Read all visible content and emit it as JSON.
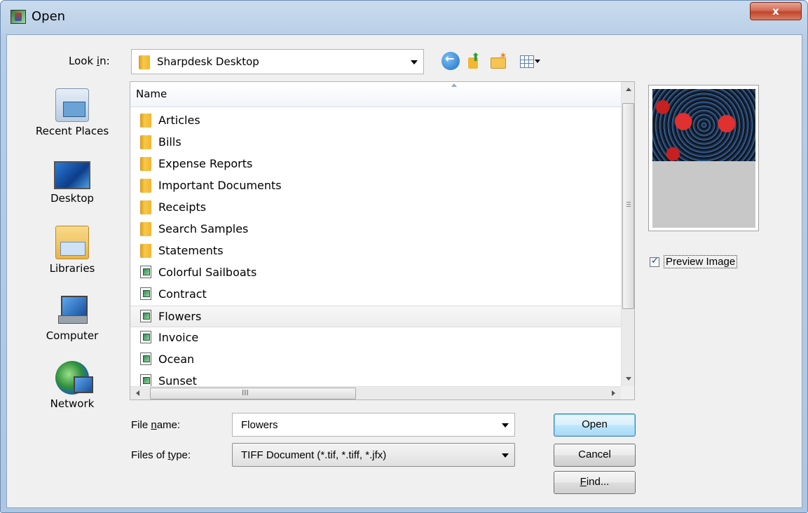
{
  "window": {
    "title": "Open",
    "close_label": "x"
  },
  "toolbar": {
    "look_in_label_pre": "Look ",
    "look_in_label_accel": "i",
    "look_in_label_post": "n:",
    "look_in_value": "Sharpdesk Desktop",
    "icons": [
      "back-icon",
      "up-folder-icon",
      "new-folder-icon",
      "views-menu-icon"
    ]
  },
  "places": [
    {
      "label": "Recent Places",
      "icon": "recent-places-icon"
    },
    {
      "label": "Desktop",
      "icon": "desktop-icon"
    },
    {
      "label": "Libraries",
      "icon": "libraries-icon"
    },
    {
      "label": "Computer",
      "icon": "computer-icon"
    },
    {
      "label": "Network",
      "icon": "network-icon"
    }
  ],
  "file_list": {
    "column_header": "Name",
    "items": [
      {
        "name": "Articles",
        "type": "folder"
      },
      {
        "name": "Bills",
        "type": "folder"
      },
      {
        "name": "Expense Reports",
        "type": "folder"
      },
      {
        "name": "Important Documents",
        "type": "folder"
      },
      {
        "name": "Receipts",
        "type": "folder"
      },
      {
        "name": "Search Samples",
        "type": "folder"
      },
      {
        "name": "Statements",
        "type": "folder"
      },
      {
        "name": "Colorful Sailboats",
        "type": "image"
      },
      {
        "name": "Contract",
        "type": "image"
      },
      {
        "name": "Flowers",
        "type": "image",
        "selected": true
      },
      {
        "name": "Invoice",
        "type": "image"
      },
      {
        "name": "Ocean",
        "type": "image"
      },
      {
        "name": "Sunset",
        "type": "image"
      }
    ],
    "hscroll_grip": "III"
  },
  "preview": {
    "checkbox_label": "Preview Image",
    "checked": true
  },
  "form": {
    "file_name_label_pre": "File ",
    "file_name_label_accel": "n",
    "file_name_label_post": "ame:",
    "file_name_value": "Flowers",
    "file_type_label_pre": "Files of ",
    "file_type_label_accel": "t",
    "file_type_label_post": "ype:",
    "file_type_value": "TIFF Document (*.tif, *.tiff, *.jfx)"
  },
  "buttons": {
    "open": "Open",
    "cancel": "Cancel",
    "find_accel": "F",
    "find_rest": "ind..."
  }
}
